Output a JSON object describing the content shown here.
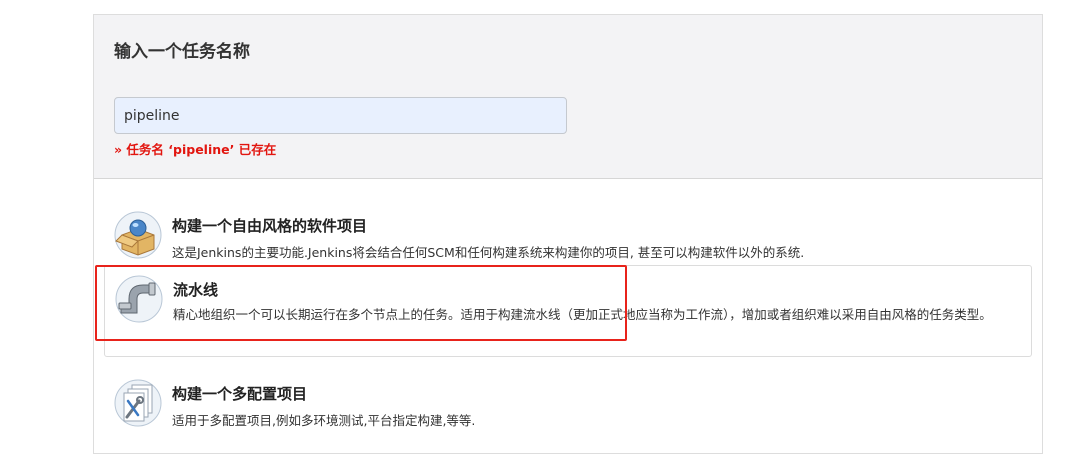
{
  "form": {
    "title": "输入一个任务名称",
    "name_value": "pipeline",
    "error": "» 任务名 ‘pipeline’ 已存在"
  },
  "items": [
    {
      "label": "构建一个自由风格的软件项目",
      "desc": "这是Jenkins的主要功能.Jenkins将会结合任何SCM和任何构建系统来构建你的项目, 甚至可以构建软件以外的系统.",
      "icon": "freestyle-box-icon"
    },
    {
      "label": "流水线",
      "desc": "精心地组织一个可以长期运行在多个节点上的任务。适用于构建流水线（更加正式地应当称为工作流），增加或者组织难以采用自由风格的任务类型。",
      "icon": "pipeline-icon"
    },
    {
      "label": "构建一个多配置项目",
      "desc": "适用于多配置项目,例如多环境测试,平台指定构建,等等.",
      "icon": "multi-config-icon"
    }
  ],
  "colors": {
    "error": "#e2150f",
    "highlight": "#e8231b",
    "input_bg": "#e8f0fe"
  }
}
